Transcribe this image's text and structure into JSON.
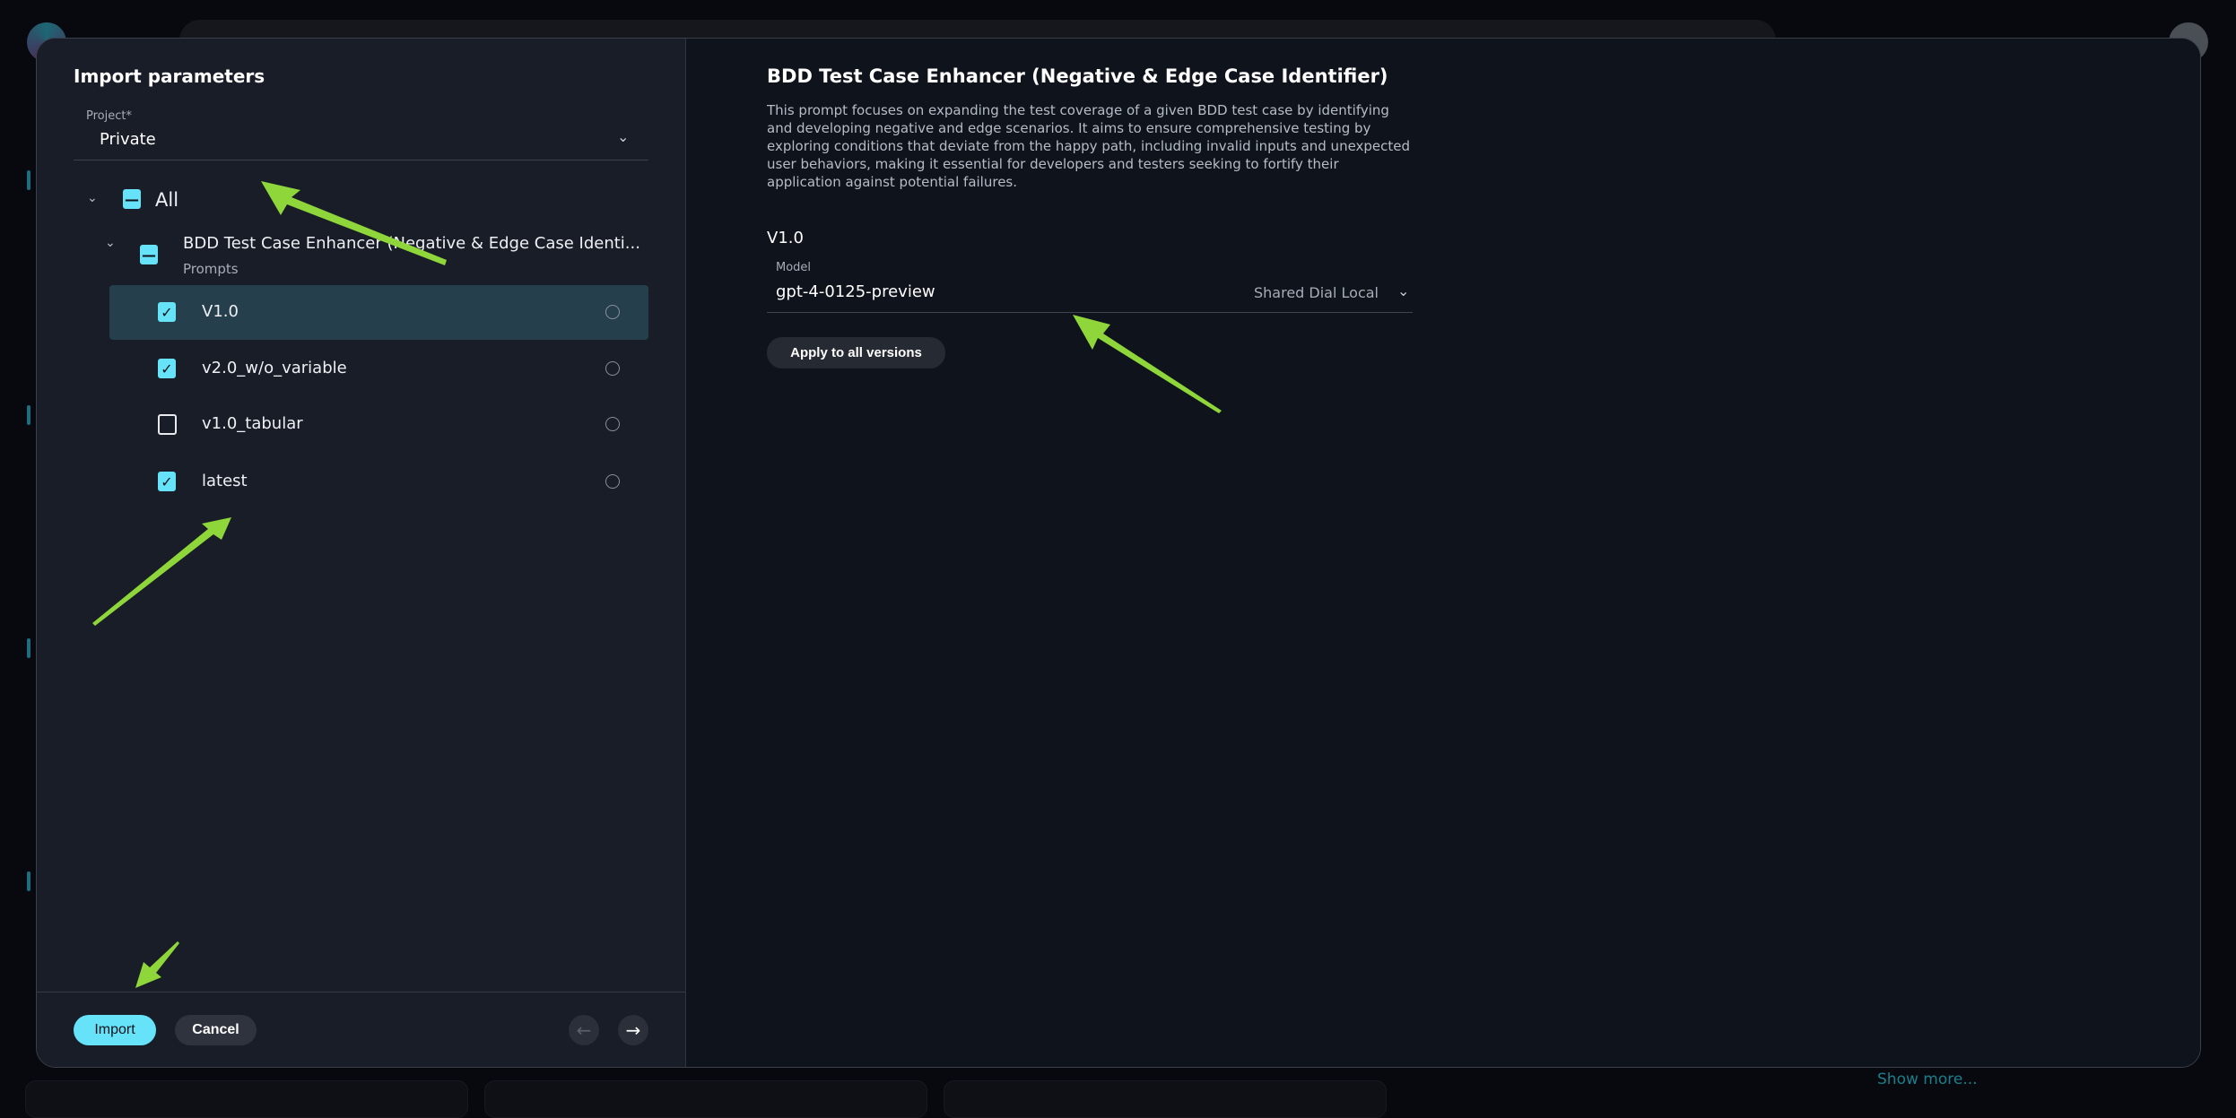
{
  "background": {
    "show_more": "Show more..."
  },
  "modal": {
    "left_panel": {
      "title": "Import parameters",
      "project_label": "Project*",
      "project_value": "Private",
      "tree": {
        "all_label": "All",
        "prompt_name": "BDD Test Case Enhancer (Negative & Edge Case Identi...",
        "prompt_type": "Prompts",
        "versions": [
          {
            "label": "V1.0",
            "checked": true,
            "selected": true
          },
          {
            "label": "v2.0_w/o_variable",
            "checked": true,
            "selected": false
          },
          {
            "label": "v1.0_tabular",
            "checked": false,
            "selected": false
          },
          {
            "label": "latest",
            "checked": true,
            "selected": false
          }
        ]
      },
      "footer": {
        "import_label": "Import",
        "cancel_label": "Cancel"
      }
    },
    "right_panel": {
      "title": "BDD Test Case Enhancer (Negative & Edge Case Identifier)",
      "description": "This prompt focuses on expanding the test coverage of a given BDD test case by identifying and developing negative and edge scenarios. It aims to ensure comprehensive testing by exploring conditions that deviate from the happy path, including invalid inputs and unexpected user behaviors, making it essential for developers and testers seeking to fortify their application against potential failures.",
      "version": "V1.0",
      "model_label": "Model",
      "model_value": "gpt-4-0125-preview",
      "model_source": "Shared Dial Local",
      "apply_label": "Apply to all versions"
    }
  },
  "colors": {
    "accent": "#66e3f8",
    "annotation_arrow": "#8fd63a",
    "selected_row": "#263f4c"
  }
}
